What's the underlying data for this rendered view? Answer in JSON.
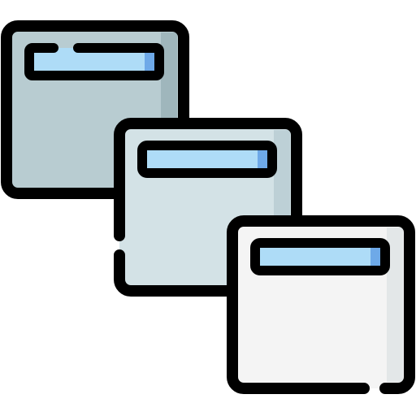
{
  "icon": {
    "name": "cascading-windows-icon",
    "colors": {
      "outline": "#000000",
      "back_window_fill": "#B8CCD1",
      "back_window_shade": "#9FB6BC",
      "middle_window_fill": "#D3E2E6",
      "middle_window_shade": "#BDD0D6",
      "front_window_fill": "#F4F4F4",
      "front_window_shade": "#E3E7E8",
      "titlebar_fill": "#AEDCF7",
      "titlebar_shade": "#6EA9E8"
    }
  }
}
